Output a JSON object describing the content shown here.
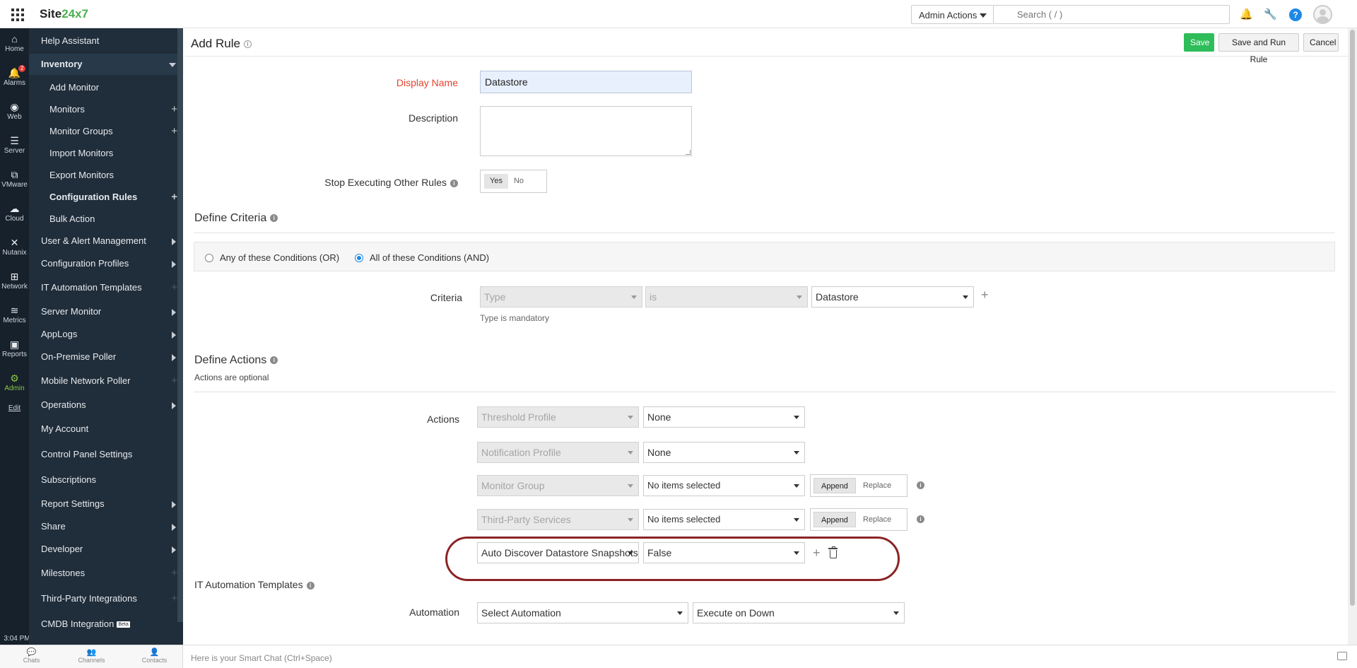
{
  "topbar": {
    "logo_prefix": "Site",
    "logo_accent": "24x7",
    "admin_actions": "Admin Actions",
    "search_placeholder": "Search ( / )",
    "help": "?"
  },
  "rail": {
    "items": [
      {
        "label": "Home",
        "glyph": "⌂"
      },
      {
        "label": "Alarms",
        "glyph": "🔔",
        "badge": "2"
      },
      {
        "label": "Web",
        "glyph": "◉"
      },
      {
        "label": "Server",
        "glyph": "☰"
      },
      {
        "label": "VMware",
        "glyph": "⧉"
      },
      {
        "label": "Cloud",
        "glyph": "☁"
      },
      {
        "label": "Nutanix",
        "glyph": "✕"
      },
      {
        "label": "Network",
        "glyph": "⊞"
      },
      {
        "label": "Metrics",
        "glyph": "≋"
      },
      {
        "label": "Reports",
        "glyph": "▣"
      },
      {
        "label": "Admin",
        "glyph": "⚙"
      },
      {
        "label": "Edit",
        "glyph": ""
      }
    ],
    "time": "3:04 PM"
  },
  "sidenav": {
    "items": [
      {
        "label": "Help Assistant"
      },
      {
        "label": "Inventory"
      },
      {
        "label": "Add Monitor"
      },
      {
        "label": "Monitors"
      },
      {
        "label": "Monitor Groups"
      },
      {
        "label": "Import Monitors"
      },
      {
        "label": "Export Monitors"
      },
      {
        "label": "Configuration Rules"
      },
      {
        "label": "Bulk Action"
      },
      {
        "label": "User & Alert Management"
      },
      {
        "label": "Configuration Profiles"
      },
      {
        "label": "IT Automation Templates"
      },
      {
        "label": "Server Monitor"
      },
      {
        "label": "AppLogs"
      },
      {
        "label": "On-Premise Poller"
      },
      {
        "label": "Mobile Network Poller"
      },
      {
        "label": "Operations"
      },
      {
        "label": "My Account"
      },
      {
        "label": "Control Panel Settings"
      },
      {
        "label": "Subscriptions"
      },
      {
        "label": "Report Settings"
      },
      {
        "label": "Share"
      },
      {
        "label": "Developer"
      },
      {
        "label": "Milestones"
      },
      {
        "label": "Third-Party Integrations"
      },
      {
        "label": "CMDB Integration"
      }
    ],
    "beta": "Beta"
  },
  "bottombar": {
    "tabs": [
      {
        "label": "Chats",
        "glyph": "💬"
      },
      {
        "label": "Channels",
        "glyph": "👥"
      },
      {
        "label": "Contacts",
        "glyph": "👤"
      }
    ],
    "smartchat": "Here is your Smart Chat (Ctrl+Space)"
  },
  "page": {
    "title": "Add Rule",
    "save": "Save",
    "save_run": "Save and Run Rule",
    "cancel": "Cancel"
  },
  "form": {
    "display_name_label": "Display Name",
    "display_name_value": "Datastore",
    "description_label": "Description",
    "stop_label": "Stop Executing Other Rules",
    "yes": "Yes",
    "no": "No"
  },
  "criteria": {
    "title": "Define Criteria",
    "or_label": "Any of these Conditions (OR)",
    "and_label": "All of these Conditions (AND)",
    "label": "Criteria",
    "field": "Type",
    "operator": "is",
    "value": "Datastore",
    "hint": "Type is mandatory"
  },
  "actions": {
    "title": "Define Actions",
    "subtitle": "Actions are optional",
    "label": "Actions",
    "append": "Append",
    "replace": "Replace",
    "rows": [
      {
        "field": "Threshold Profile",
        "value": "None"
      },
      {
        "field": "Notification Profile",
        "value": "None"
      },
      {
        "field": "Monitor Group",
        "value": "No items selected"
      },
      {
        "field": "Third-Party Services",
        "value": "No items selected"
      },
      {
        "field": "Auto Discover Datastore Snapshots",
        "value": "False"
      }
    ]
  },
  "automation": {
    "title": "IT Automation Templates",
    "label": "Automation",
    "select": "Select Automation",
    "execute": "Execute on Down"
  }
}
